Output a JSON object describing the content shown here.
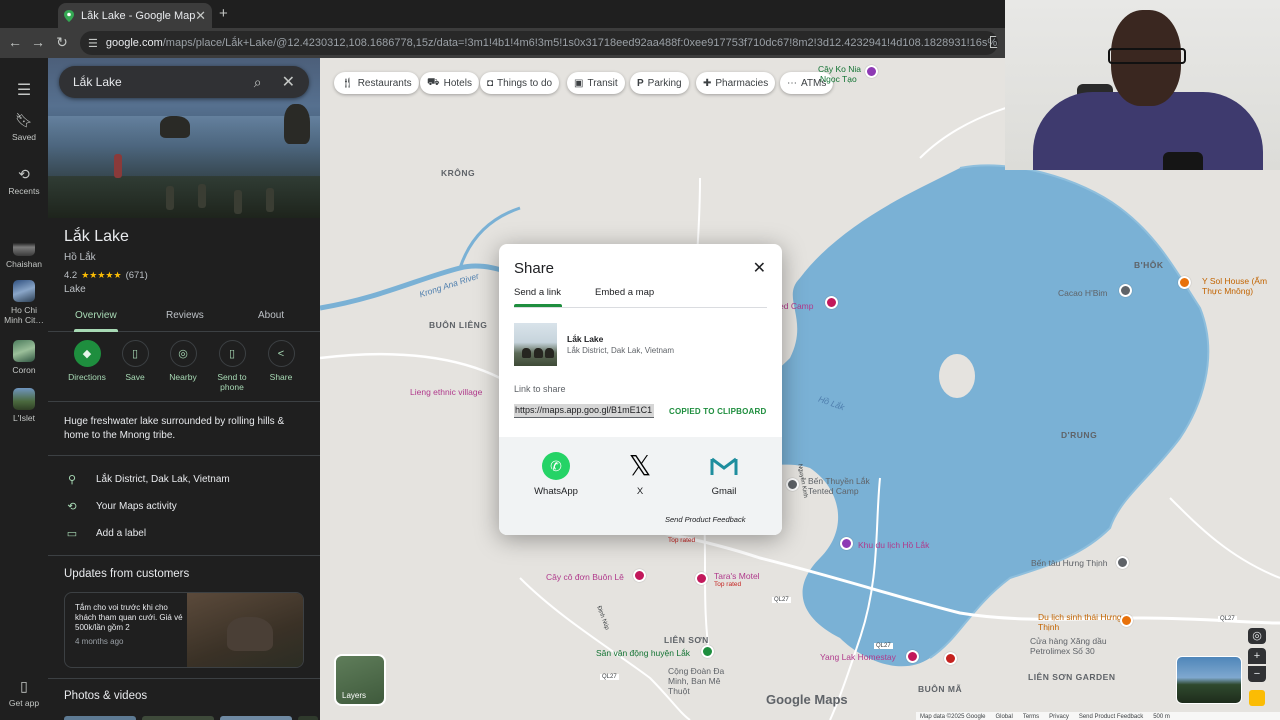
{
  "browser": {
    "tab_title": "Lắk Lake - Google Maps",
    "new_tab": "+",
    "url_host": "google.com",
    "url_path": "/maps/place/Lắk+Lake/@12.4230312,108.1686778,15z/data=!3m1!4b1!4m6!3m5!1s0x31718eed92aa488f:0xee917753f710dc67!8m2!3d12.4232941!4d108.1828931!16s%2Fg%2F121f8ztd?e…"
  },
  "rail": {
    "items": [
      {
        "label": "Saved"
      },
      {
        "label": "Recents"
      },
      {
        "label": "Chaishan"
      },
      {
        "label": "Ho Chi Minh Cit…"
      },
      {
        "label": "Coron"
      },
      {
        "label": "L'Islet"
      },
      {
        "label": "Get app"
      }
    ]
  },
  "search": {
    "query": "Lắk Lake"
  },
  "place": {
    "name": "Lắk Lake",
    "local_name": "Hồ Lắk",
    "rating": "4.2",
    "stars": "★★★★★",
    "reviews_count": "(671)",
    "type": "Lake",
    "tabs": [
      "Overview",
      "Reviews",
      "About"
    ],
    "actions": [
      "Directions",
      "Save",
      "Nearby",
      "Send to phone",
      "Share"
    ],
    "description": "Huge freshwater lake surrounded by rolling hills & home to the Mnong tribe.",
    "address": "Lắk District, Dak Lak, Vietnam",
    "activity": "Your Maps activity",
    "add_label": "Add a label",
    "updates_title": "Updates from customers",
    "update_text": "Tắm cho voi trước khi cho khách tham quan cưới. Giá vé 500k/lần gồm 2",
    "update_time": "4 months ago",
    "photos_title": "Photos & videos"
  },
  "map": {
    "chips": [
      "Restaurants",
      "Hotels",
      "Things to do",
      "Transit",
      "Parking",
      "Pharmacies",
      "ATMs"
    ],
    "labels": {
      "krong": "KRÔNG",
      "buon_lieng": "BUÔN LIÊNG",
      "b_hok": "B'HÔK",
      "d_rung": "D'RUNG",
      "lien_son": "LIÊN SƠN",
      "buon_ma": "BUÔN MÃ",
      "lien_son_garden": "LIÊN SƠN GARDEN",
      "krong_ana": "Krong Ana River",
      "ho_lak": "Hồ Lắk",
      "lieng_village": "Lieng ethnic village",
      "cay_ko_nia": "Cây Ko Nia",
      "ngoc_tao": "Ngọc Tạo",
      "cacao": "Cacao H'Bim",
      "y_sol": "Y Sol House (Ẩm Thực Mnông)",
      "camp": "ed Camp",
      "ben_thuyen": "Bến Thuyền Lắk Tented Camp",
      "khu_du_lich": "Khu du lịch Hồ Lắk",
      "ben_tau": "Bến tàu Hưng Thịnh",
      "du_lich_sinh_thai": "Du lịch sinh thái Hưng Thịnh",
      "cua_hang": "Cửa hàng Xăng dầu Petrolimex Số 30",
      "cay_co_don": "Cây cô đơn Buôn Lê",
      "taras": "Tara's Motel",
      "top_rated": "Top rated",
      "san_van_dong": "Sân vận động huyện Lắk",
      "cong_doan": "Cộng Đoàn Đa Minh, Ban Mê Thuột",
      "yang_lak": "Yang Lak Homestay",
      "ngo_kinh": "Nguyễn Kinh",
      "dinh_nguyen": "Định Núp",
      "ql27": "QL27"
    },
    "layers": "Layers",
    "logo": "Google Maps",
    "attribution": [
      "Map data ©2025 Google",
      "Global",
      "Terms",
      "Privacy",
      "Send Product Feedback",
      "500 m"
    ]
  },
  "share": {
    "title": "Share",
    "tab_link": "Send a link",
    "tab_embed": "Embed a map",
    "name": "Lắk Lake",
    "address": "Lắk District, Dak Lak, Vietnam",
    "link_label": "Link to share",
    "link": "https://maps.app.goo.gl/B1mE1C1",
    "copied": "COPIED TO CLIPBOARD",
    "options": [
      "WhatsApp",
      "X",
      "Gmail"
    ],
    "feedback": "Send Product Feedback"
  }
}
